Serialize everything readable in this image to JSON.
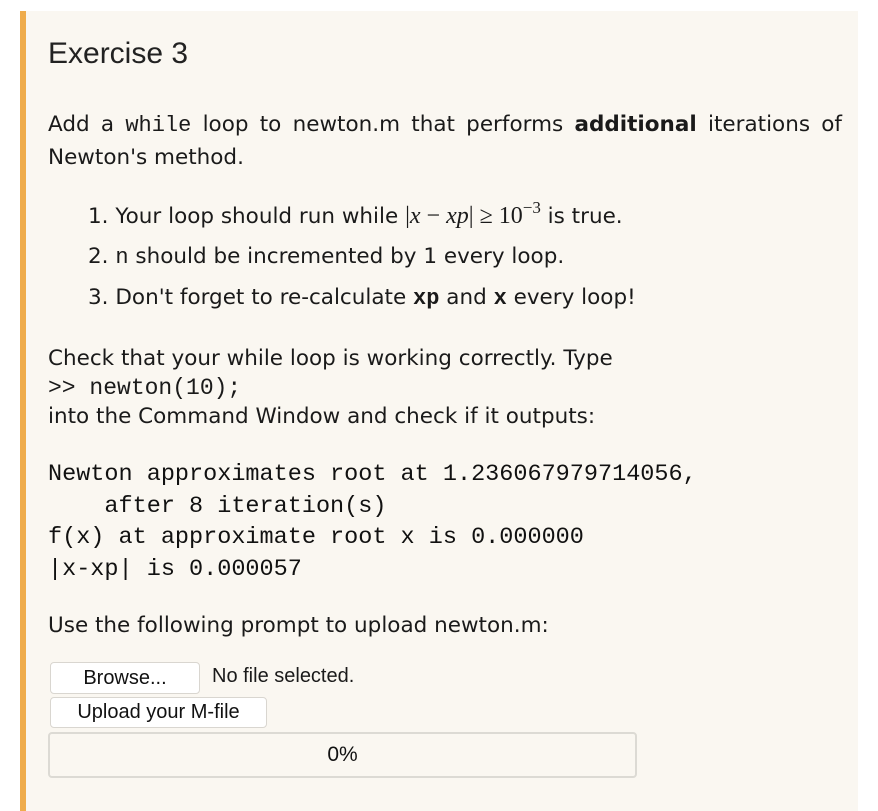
{
  "exercise": {
    "title": "Exercise 3",
    "intro": {
      "part1": "Add a ",
      "code_while": "while",
      "part2": " loop to newton.m that performs ",
      "bold": "additional",
      "part3": " iterations of Newton's method."
    },
    "steps": [
      {
        "num": "1.",
        "text_before": "Your loop should run while ",
        "math": {
          "open": "|",
          "x": "x",
          "minus": " − ",
          "xp": "xp",
          "close": "|",
          "geq": " ≥ ",
          "base": "10",
          "exp": "−3"
        },
        "text_after": " is true."
      },
      {
        "num": "2.",
        "code": "n",
        "text": " should be incremented by 1 every loop."
      },
      {
        "num": "3.",
        "text_before": "Don't forget to re-calculate ",
        "code1": "xp",
        "text_mid": " and ",
        "code2": "x",
        "text_after": " every loop!"
      }
    ],
    "check": {
      "line1": "Check that your while loop is working correctly. Type",
      "command": ">> newton(10);",
      "line2": "into the Command Window and check if it outputs:"
    },
    "expected_output": [
      "Newton approximates root at 1.236067979714056,",
      "    after 8 iteration(s)",
      "f(x) at approximate root x is 0.000000",
      "|x-xp| is 0.000057"
    ],
    "upload": {
      "prompt": "Use the following prompt to upload newton.m:",
      "browse_label": "Browse...",
      "file_status": "No file selected.",
      "upload_label": "Upload your M-file",
      "progress_label": "0%",
      "progress_value": 0
    }
  },
  "colors": {
    "accent": "#efac4c",
    "panel_bg": "#faf7f1"
  }
}
